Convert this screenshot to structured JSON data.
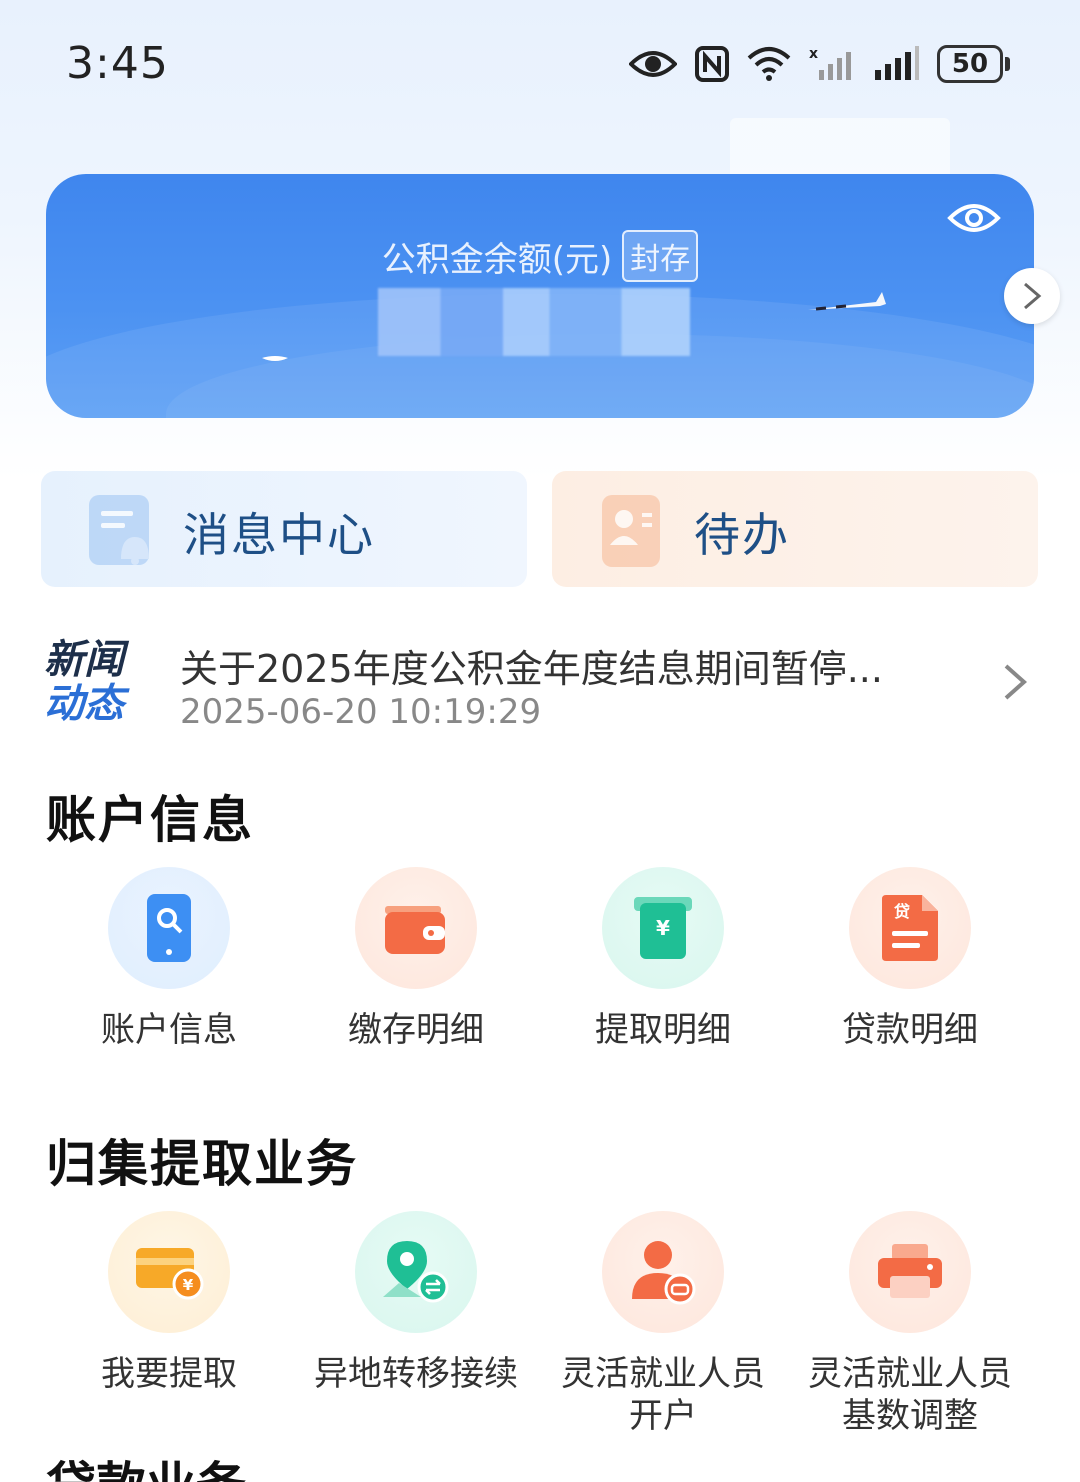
{
  "status_bar": {
    "time": "3:45",
    "battery": "50"
  },
  "balance_card": {
    "title": "公积金余额(元)",
    "status_tag": "封存"
  },
  "quick_tiles": {
    "message_center": "消息中心",
    "todo": "待办"
  },
  "news": {
    "logo_line1": "新闻",
    "logo_line2": "动态",
    "title": "关于2025年度公积金年度结息期间暂停...",
    "datetime": "2025-06-20 10:19:29"
  },
  "account_section": {
    "title": "账户信息",
    "items": [
      {
        "label": "账户信息",
        "icon": "phone-search-icon"
      },
      {
        "label": "缴存明细",
        "icon": "wallet-icon"
      },
      {
        "label": "提取明细",
        "icon": "yuan-envelope-icon"
      },
      {
        "label": "贷款明细",
        "icon": "loan-document-icon"
      }
    ]
  },
  "withdraw_section": {
    "title": "归集提取业务",
    "items": [
      {
        "label": "我要提取",
        "icon": "card-yuan-icon"
      },
      {
        "label": "异地转移接续",
        "icon": "location-transfer-icon"
      },
      {
        "label_line1": "灵活就业人员",
        "label_line2": "开户",
        "icon": "person-card-icon"
      },
      {
        "label_line1": "灵活就业人员",
        "label_line2": "基数调整",
        "icon": "printer-icon"
      }
    ]
  },
  "next_section": {
    "title": "贷款业务"
  },
  "colors": {
    "card_blue": "#4a8ff1",
    "accent_orange": "#f36b45",
    "accent_green": "#1fbf95",
    "accent_blue": "#3d8ff3",
    "accent_yellow": "#f7a928"
  }
}
